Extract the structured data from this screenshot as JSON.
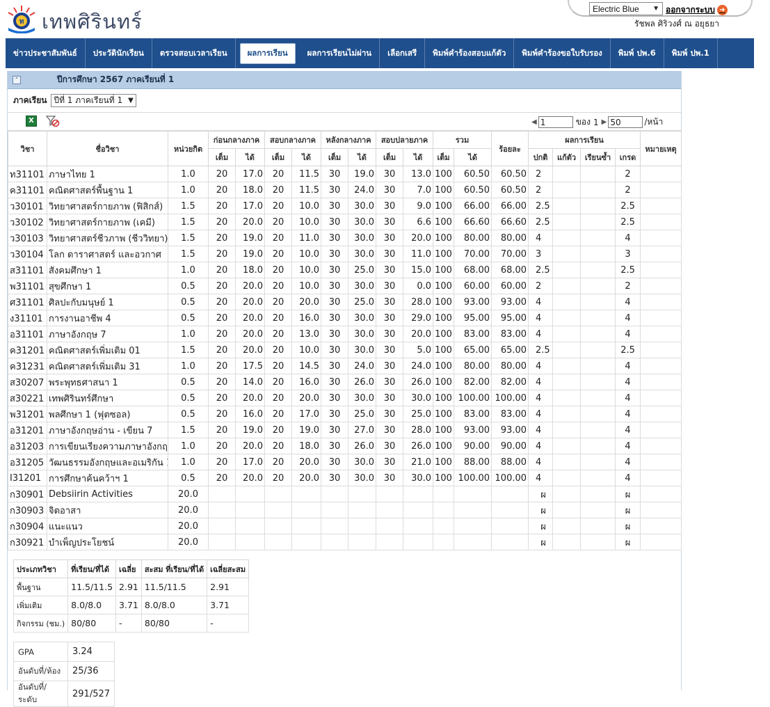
{
  "header": {
    "brand": "เทพศิรินทร์",
    "theme_selected": "Electric Blue",
    "logout_label": "ออกจากระบบ",
    "username": "รัชพล ศิริวงศ์ ณ อยุธยา"
  },
  "nav": [
    "ข่าวประชาสัมพันธ์",
    "ประวัตินักเรียน",
    "ตรวจสอบเวลาเรียน",
    "ผลการเรียน",
    "ผลการเรียนไม่ผ่าน",
    "เลือกเสรี",
    "พิมพ์คำร้องสอบแก้ตัว",
    "พิมพ์คำร้องขอใบรับรอง",
    "พิมพ์ ปพ.6",
    "พิมพ์ ปพ.1"
  ],
  "nav_active_index": 3,
  "panel": {
    "title": "ปีการศึกษา 2567 ภาคเรียนที่ 1",
    "semester_label": "ภาคเรียน",
    "semester_value": "ปีที่ 1 ภาคเรียนที่ 1",
    "pager": {
      "page": "1",
      "of_label": "ของ",
      "total": "1",
      "per_page": "50",
      "per_page_suffix": "/หน้า"
    }
  },
  "columns": {
    "code": "วิชา",
    "name": "ชื่อวิชา",
    "credit": "หน่วยกิต",
    "groups": [
      "ก่อนกลางภาค",
      "สอบกลางภาค",
      "หลังกลางภาค",
      "สอบปลายภาค",
      "รวม"
    ],
    "full": "เต็ม",
    "got": "ได้",
    "percent": "ร้อยละ",
    "result": "ผลการเรียน",
    "result_sub": [
      "ปกติ",
      "แก้ตัว",
      "เรียนซ้ำ",
      "เกรด"
    ],
    "note": "หมายเหตุ"
  },
  "rows": [
    [
      "ท31101",
      "ภาษาไทย 1",
      "1.0",
      "20",
      "17.0",
      "20",
      "11.5",
      "30",
      "19.0",
      "30",
      "13.0",
      "100",
      "60.50",
      "60.50",
      "2",
      "",
      "",
      "2",
      ""
    ],
    [
      "ค31101",
      "คณิตศาสตร์พื้นฐาน 1",
      "1.0",
      "20",
      "18.0",
      "20",
      "11.5",
      "30",
      "24.0",
      "30",
      "7.0",
      "100",
      "60.50",
      "60.50",
      "2",
      "",
      "",
      "2",
      ""
    ],
    [
      "ว30101",
      "วิทยาศาสตร์กายภาพ (ฟิสิกส์)",
      "1.5",
      "20",
      "17.0",
      "20",
      "10.0",
      "30",
      "30.0",
      "30",
      "9.0",
      "100",
      "66.00",
      "66.00",
      "2.5",
      "",
      "",
      "2.5",
      ""
    ],
    [
      "ว30102",
      "วิทยาศาสตร์กายภาพ (เคมี)",
      "1.5",
      "20",
      "20.0",
      "20",
      "10.0",
      "30",
      "30.0",
      "30",
      "6.6",
      "100",
      "66.60",
      "66.60",
      "2.5",
      "",
      "",
      "2.5",
      ""
    ],
    [
      "ว30103",
      "วิทยาศาสตร์ชีวภาพ (ชีววิทยา)",
      "1.5",
      "20",
      "19.0",
      "20",
      "11.0",
      "30",
      "30.0",
      "30",
      "20.0",
      "100",
      "80.00",
      "80.00",
      "4",
      "",
      "",
      "4",
      ""
    ],
    [
      "ว30104",
      "โลก ดาราศาสตร์ และอวกาศ",
      "1.5",
      "20",
      "19.0",
      "20",
      "10.0",
      "30",
      "30.0",
      "30",
      "11.0",
      "100",
      "70.00",
      "70.00",
      "3",
      "",
      "",
      "3",
      ""
    ],
    [
      "ส31101",
      "สังคมศึกษา 1",
      "1.0",
      "20",
      "18.0",
      "20",
      "10.0",
      "30",
      "25.0",
      "30",
      "15.0",
      "100",
      "68.00",
      "68.00",
      "2.5",
      "",
      "",
      "2.5",
      ""
    ],
    [
      "พ31101",
      "สุขศึกษา 1",
      "0.5",
      "20",
      "20.0",
      "20",
      "10.0",
      "30",
      "30.0",
      "30",
      "0.0",
      "100",
      "60.00",
      "60.00",
      "2",
      "",
      "",
      "2",
      ""
    ],
    [
      "ศ31101",
      "ศิลปะกับมนุษย์ 1",
      "0.5",
      "20",
      "20.0",
      "20",
      "20.0",
      "30",
      "25.0",
      "30",
      "28.0",
      "100",
      "93.00",
      "93.00",
      "4",
      "",
      "",
      "4",
      ""
    ],
    [
      "ง31101",
      "การงานอาชีพ 4",
      "0.5",
      "20",
      "20.0",
      "20",
      "16.0",
      "30",
      "30.0",
      "30",
      "29.0",
      "100",
      "95.00",
      "95.00",
      "4",
      "",
      "",
      "4",
      ""
    ],
    [
      "อ31101",
      "ภาษาอังกฤษ 7",
      "1.0",
      "20",
      "20.0",
      "20",
      "13.0",
      "30",
      "30.0",
      "30",
      "20.0",
      "100",
      "83.00",
      "83.00",
      "4",
      "",
      "",
      "4",
      ""
    ],
    [
      "ค31201",
      "คณิตศาสตร์เพิ่มเติม 01",
      "1.5",
      "20",
      "20.0",
      "20",
      "10.0",
      "30",
      "30.0",
      "30",
      "5.0",
      "100",
      "65.00",
      "65.00",
      "2.5",
      "",
      "",
      "2.5",
      ""
    ],
    [
      "ค31231",
      "คณิตศาสตร์เพิ่มเติม 31",
      "1.0",
      "20",
      "17.5",
      "20",
      "14.5",
      "30",
      "24.0",
      "30",
      "24.0",
      "100",
      "80.00",
      "80.00",
      "4",
      "",
      "",
      "4",
      ""
    ],
    [
      "ส30207",
      "พระพุทธศาสนา 1",
      "0.5",
      "20",
      "14.0",
      "20",
      "16.0",
      "30",
      "26.0",
      "30",
      "26.0",
      "100",
      "82.00",
      "82.00",
      "4",
      "",
      "",
      "4",
      ""
    ],
    [
      "ส30221",
      "เทพศิรินทร์ศึกษา",
      "0.5",
      "20",
      "20.0",
      "20",
      "20.0",
      "30",
      "30.0",
      "30",
      "30.0",
      "100",
      "100.00",
      "100.00",
      "4",
      "",
      "",
      "4",
      ""
    ],
    [
      "พ31201",
      "พลศึกษา 1 (ฟุตซอล)",
      "0.5",
      "20",
      "16.0",
      "20",
      "17.0",
      "30",
      "25.0",
      "30",
      "25.0",
      "100",
      "83.00",
      "83.00",
      "4",
      "",
      "",
      "4",
      ""
    ],
    [
      "อ31201",
      "ภาษาอังกฤษอ่าน - เขียน 7",
      "1.5",
      "20",
      "19.0",
      "20",
      "19.0",
      "30",
      "27.0",
      "30",
      "28.0",
      "100",
      "93.00",
      "93.00",
      "4",
      "",
      "",
      "4",
      ""
    ],
    [
      "อ31203",
      "การเขียนเรียงความภาษาอังกฤษ 1",
      "1.0",
      "20",
      "20.0",
      "20",
      "18.0",
      "30",
      "26.0",
      "30",
      "26.0",
      "100",
      "90.00",
      "90.00",
      "4",
      "",
      "",
      "4",
      ""
    ],
    [
      "อ31205",
      "วัฒนธรรมอังกฤษและอเมริกัน 1",
      "1.0",
      "20",
      "17.0",
      "20",
      "20.0",
      "30",
      "30.0",
      "30",
      "21.0",
      "100",
      "88.00",
      "88.00",
      "4",
      "",
      "",
      "4",
      ""
    ],
    [
      "I31201",
      "การศึกษาค้นคว้าฯ 1",
      "0.5",
      "20",
      "20.0",
      "20",
      "20.0",
      "30",
      "30.0",
      "30",
      "30.0",
      "100",
      "100.00",
      "100.00",
      "4",
      "",
      "",
      "4",
      ""
    ],
    [
      "ก30901",
      "Debsiirin Activities",
      "20.0",
      "",
      "",
      "",
      "",
      "",
      "",
      "",
      "",
      "",
      "",
      "",
      "ผ",
      "",
      "",
      "ผ",
      ""
    ],
    [
      "ก30903",
      "จิตอาสา",
      "20.0",
      "",
      "",
      "",
      "",
      "",
      "",
      "",
      "",
      "",
      "",
      "",
      "ผ",
      "",
      "",
      "ผ",
      ""
    ],
    [
      "ก30904",
      "แนะแนว",
      "20.0",
      "",
      "",
      "",
      "",
      "",
      "",
      "",
      "",
      "",
      "",
      "",
      "ผ",
      "",
      "",
      "ผ",
      ""
    ],
    [
      "ก30921",
      "บำเพ็ญประโยชน์",
      "20.0",
      "",
      "",
      "",
      "",
      "",
      "",
      "",
      "",
      "",
      "",
      "",
      "ผ",
      "",
      "",
      "ผ",
      ""
    ]
  ],
  "summary": {
    "headers": [
      "ประเภทวิชา",
      "ที่เรียน/ที่ได้",
      "เฉลี่ย",
      "สะสม ที่เรียน/ที่ได้",
      "เฉลี่ยสะสม"
    ],
    "rows": [
      [
        "พื้นฐาน",
        "11.5/11.5",
        "2.91",
        "11.5/11.5",
        "2.91"
      ],
      [
        "เพิ่มเติม",
        "8.0/8.0",
        "3.71",
        "8.0/8.0",
        "3.71"
      ],
      [
        "กิจกรรม (ชม.)",
        "80/80",
        "-",
        "80/80",
        "-"
      ]
    ]
  },
  "gpa": [
    [
      "GPA",
      "3.24"
    ],
    [
      "อันดับที่/ห้อง",
      "25/36"
    ],
    [
      "อันดับที่/ระดับ",
      "291/527"
    ]
  ]
}
